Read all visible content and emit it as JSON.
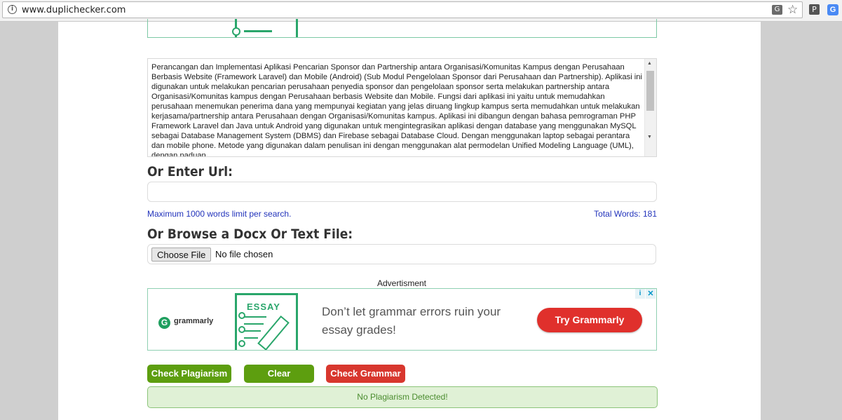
{
  "browser": {
    "url": "www.duplichecker.com",
    "info_glyph": "i",
    "translate_glyph": "G",
    "star_glyph": "☆",
    "ext1_glyph": "P",
    "ext2_glyph": "G"
  },
  "editor": {
    "text": "Perancangan dan Implementasi Aplikasi Pencarian Sponsor dan Partnership antara Organisasi/Komunitas Kampus dengan Perusahaan Berbasis Website (Framework Laravel) dan Mobile (Android) (Sub Modul Pengelolaan Sponsor dari Perusahaan dan Partnership). Aplikasi ini digunakan untuk melakukan pencarian perusahaan penyedia sponsor dan pengelolaan sponsor serta melakukan partnership antara Organisasi/Komunitas kampus dengan Perusahaan berbasis Website dan Mobile. Fungsi dari aplikasi ini yaitu untuk memudahkan perusahaan menemukan penerima dana yang mempunyai kegiatan yang jelas diruang lingkup kampus serta memudahkan untuk melakukan kerjasama/partnership antara Perusahaan dengan Organisasi/Komunitas kampus. Aplikasi ini dibangun dengan bahasa pemrograman PHP Framework Laravel dan Java untuk Android yang digunakan untuk mengintegrasikan aplikasi dengan database yang menggunakan MySQL sebagai Database Management System (DBMS) dan Firebase sebagai Database Cloud. Dengan menggunakan laptop sebagai perantara dan mobile phone. Metode yang digunakan dalam penulisan ini dengan menggunakan alat permodelan Unified Modeling Language (UML), dengan paduan"
  },
  "url_section": {
    "heading": "Or Enter Url:",
    "value": "",
    "limit_text": "Maximum 1000 words limit per search.",
    "total_words": "Total Words: 181"
  },
  "file_section": {
    "heading": "Or Browse a Docx Or Text File:",
    "choose_label": "Choose File",
    "status": "No file chosen"
  },
  "ad": {
    "label": "Advertisment",
    "brand": "grammarly",
    "book_title": "ESSAY",
    "copy": "Don’t let grammar errors ruin your essay grades!",
    "cta": "Try Grammarly",
    "adchoice_glyph": "i",
    "close_glyph": "✕"
  },
  "actions": {
    "check_plagiarism": "Check Plagiarism",
    "clear": "Clear",
    "check_grammar": "Check Grammar"
  },
  "result": {
    "message": "No Plagiarism Detected!"
  },
  "colors": {
    "primary_green": "#5d9e0f",
    "grammar_red": "#d8372e",
    "link_blue": "#2233bb",
    "result_bg": "#e0f1d6"
  }
}
